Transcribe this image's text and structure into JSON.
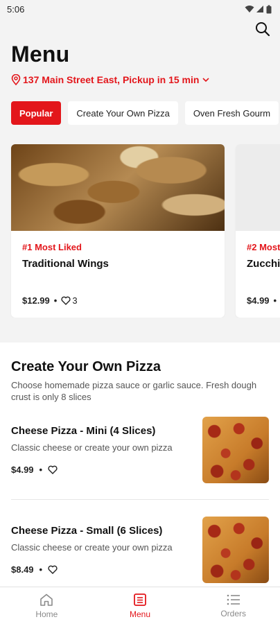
{
  "status_bar": {
    "time": "5:06"
  },
  "header": {
    "title": "Menu",
    "location_text": "137 Main Street East, Pickup in 15 min"
  },
  "chips": [
    "Popular",
    "Create Your Own Pizza",
    "Oven Fresh Gourm"
  ],
  "featured": [
    {
      "rank": "#1 Most Liked",
      "name": "Traditional Wings",
      "price": "$12.99",
      "likes": "3"
    },
    {
      "rank": "#2 Most",
      "name": "Zucchi",
      "price": "$4.99",
      "likes": ""
    }
  ],
  "section": {
    "title": "Create Your Own Pizza",
    "description": "Choose homemade pizza sauce or garlic sauce. Fresh dough crust is only 8 slices",
    "items": [
      {
        "name": "Cheese Pizza - Mini (4 Slices)",
        "description": "Classic cheese or create your own pizza",
        "price": "$4.99"
      },
      {
        "name": "Cheese Pizza - Small (6 Slices)",
        "description": "Classic cheese or create your own pizza",
        "price": "$8.49"
      }
    ]
  },
  "bottom_nav": [
    {
      "label": "Home",
      "icon": "home-icon"
    },
    {
      "label": "Menu",
      "icon": "menu-icon"
    },
    {
      "label": "Orders",
      "icon": "orders-icon"
    }
  ],
  "colors": {
    "accent": "#e3161b",
    "muted": "#8a8a8a"
  }
}
